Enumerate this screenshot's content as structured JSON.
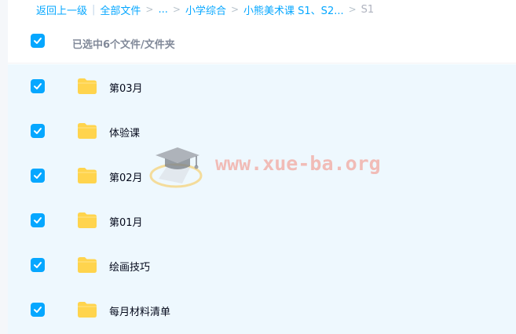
{
  "breadcrumb": {
    "back": "返回上一级",
    "divider": "|",
    "items": [
      "全部文件",
      "...",
      "小学综合",
      "小熊美术课 S1、S2..."
    ],
    "current": "S1",
    "separator": ">"
  },
  "header": {
    "selection_text": "已选中6个文件/文件夹"
  },
  "files": [
    {
      "name": "第03月",
      "checked": true,
      "type": "folder"
    },
    {
      "name": "体验课",
      "checked": true,
      "type": "folder"
    },
    {
      "name": "第02月",
      "checked": true,
      "type": "folder"
    },
    {
      "name": "第01月",
      "checked": true,
      "type": "folder"
    },
    {
      "name": "绘画技巧",
      "checked": true,
      "type": "folder"
    },
    {
      "name": "每月材料清单",
      "checked": true,
      "type": "folder"
    }
  ],
  "watermark": {
    "text": "www.xue-ba.org",
    "icon": "graduation-cap-icon"
  },
  "colors": {
    "accent": "#06a7ff",
    "row_selected_bg": "#eef8fe",
    "folder": "#ffd44d",
    "watermark": "#f2b2ab"
  }
}
